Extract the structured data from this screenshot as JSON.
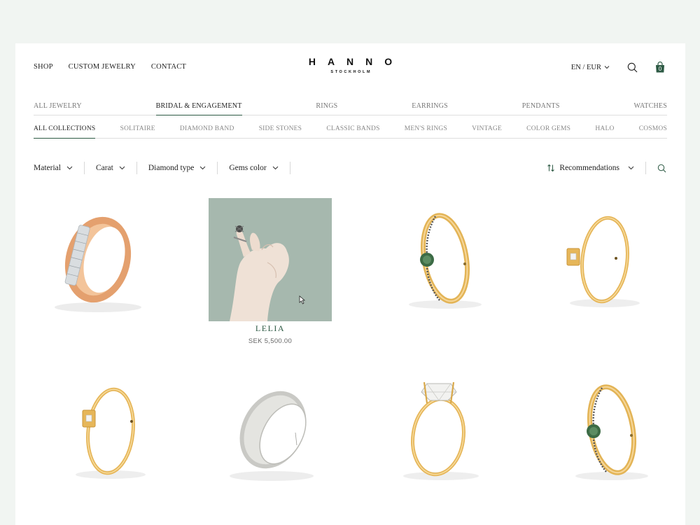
{
  "header": {
    "nav": [
      "SHOP",
      "CUSTOM JEWELRY",
      "CONTACT"
    ],
    "logo": {
      "name": "HANNO",
      "subtitle": "STOCKHOLM"
    },
    "language": "EN / EUR",
    "cart_count": "0"
  },
  "categories": {
    "items": [
      "ALL JEWELRY",
      "BRIDAL & ENGAGEMENT",
      "RINGS",
      "EARRINGS",
      "PENDANTS",
      "WATCHES"
    ],
    "active": "BRIDAL & ENGAGEMENT"
  },
  "collections": {
    "items": [
      "ALL COLLECTIONS",
      "SOLITAIRE",
      "DIAMOND BAND",
      "SIDE STONES",
      "CLASSIC BANDS",
      "MEN'S RINGS",
      "VINTAGE",
      "COLOR GEMS",
      "HALO",
      "COSMOS"
    ],
    "active": "ALL COLLECTIONS"
  },
  "filters": {
    "material": "Material",
    "carat": "Carat",
    "diamond_type": "Diamond type",
    "gems_color": "Gems color",
    "sort": "Recommendations"
  },
  "hovered_product": {
    "name": "LELIA",
    "price": "SEK  5,500.00"
  },
  "products": [
    {
      "icon": "baguette-eternity-band-icon"
    },
    {
      "icon": "hand-wearing-ring-photo"
    },
    {
      "icon": "green-gem-side-stone-ring-icon"
    },
    {
      "icon": "square-bezel-solitaire-ring-icon"
    },
    {
      "icon": "square-bezel-solitaire-ring-icon"
    },
    {
      "icon": "white-gold-wedding-band-icon"
    },
    {
      "icon": "cushion-diamond-solitaire-ring-icon"
    },
    {
      "icon": "green-gem-side-stone-ring-icon"
    }
  ],
  "colors": {
    "accent": "#2d5a44",
    "gold": "#e3b456",
    "rose_gold": "#e8a874",
    "background": "#f1f5f2"
  }
}
